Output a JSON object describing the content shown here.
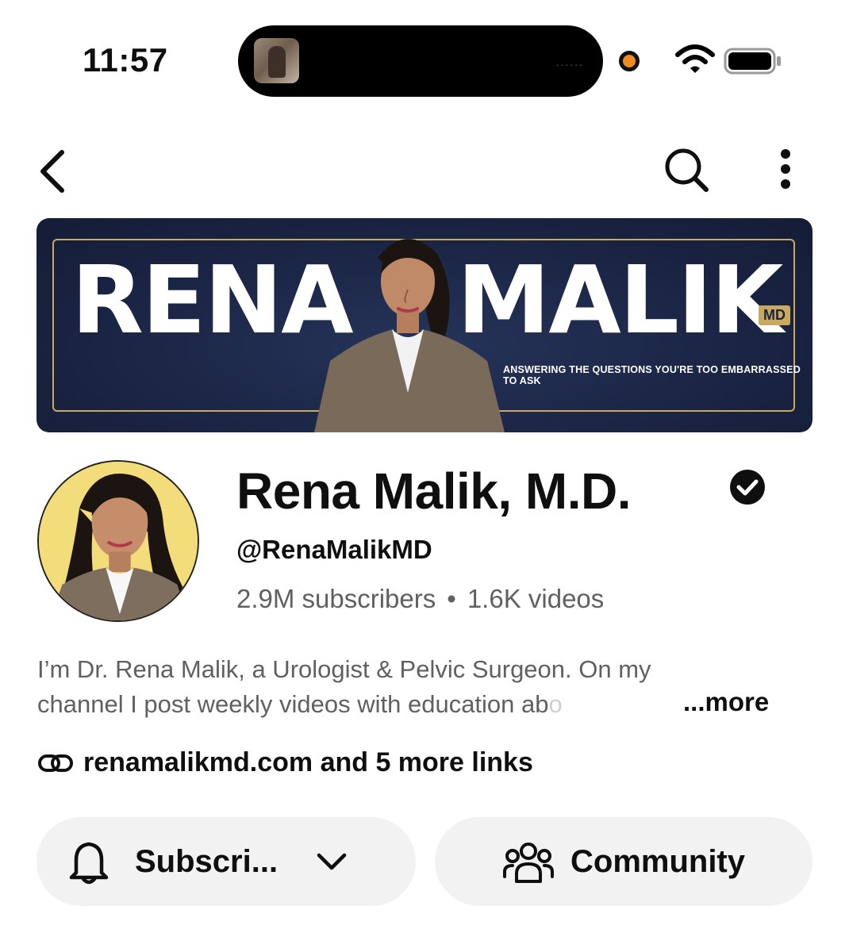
{
  "status_bar": {
    "time": "11:57",
    "island_dots": "......"
  },
  "banner": {
    "word_left": "RENA",
    "word_right": "MALIK",
    "suffix": "MD",
    "tagline": "ANSWERING THE QUESTIONS YOU'RE TOO EMBARRASSED TO ASK"
  },
  "channel": {
    "name": "Rena Malik, M.D.",
    "handle": "@RenaMalikMD",
    "subscribers": "2.9M subscribers",
    "separator": "•",
    "videos": "1.6K videos",
    "description_line1": "I’m Dr. Rena Malik, a Urologist & Pelvic Surgeon. On my",
    "description_line2": "channel I post weekly videos with education ab",
    "description_fade": "o",
    "more_label": "...more",
    "links_text": "renamalikmd.com and 5 more links"
  },
  "actions": {
    "subscribe_label": "Subscri...",
    "community_label": "Community"
  },
  "colors": {
    "banner_navy": "#1a2443",
    "banner_gold": "#c9a95f",
    "avatar_bg": "#f3dc7a",
    "pill_bg": "#f2f2f2",
    "secondary_text": "#606060",
    "recording_dot": "#f08a24"
  },
  "icons": {
    "back": "chevron-left-icon",
    "search": "search-icon",
    "more": "vertical-dots-icon",
    "verified": "verified-check-icon",
    "link": "link-icon",
    "bell": "bell-icon",
    "dropdown": "chevron-down-icon",
    "community": "people-group-icon",
    "wifi": "wifi-icon",
    "battery": "battery-icon"
  }
}
